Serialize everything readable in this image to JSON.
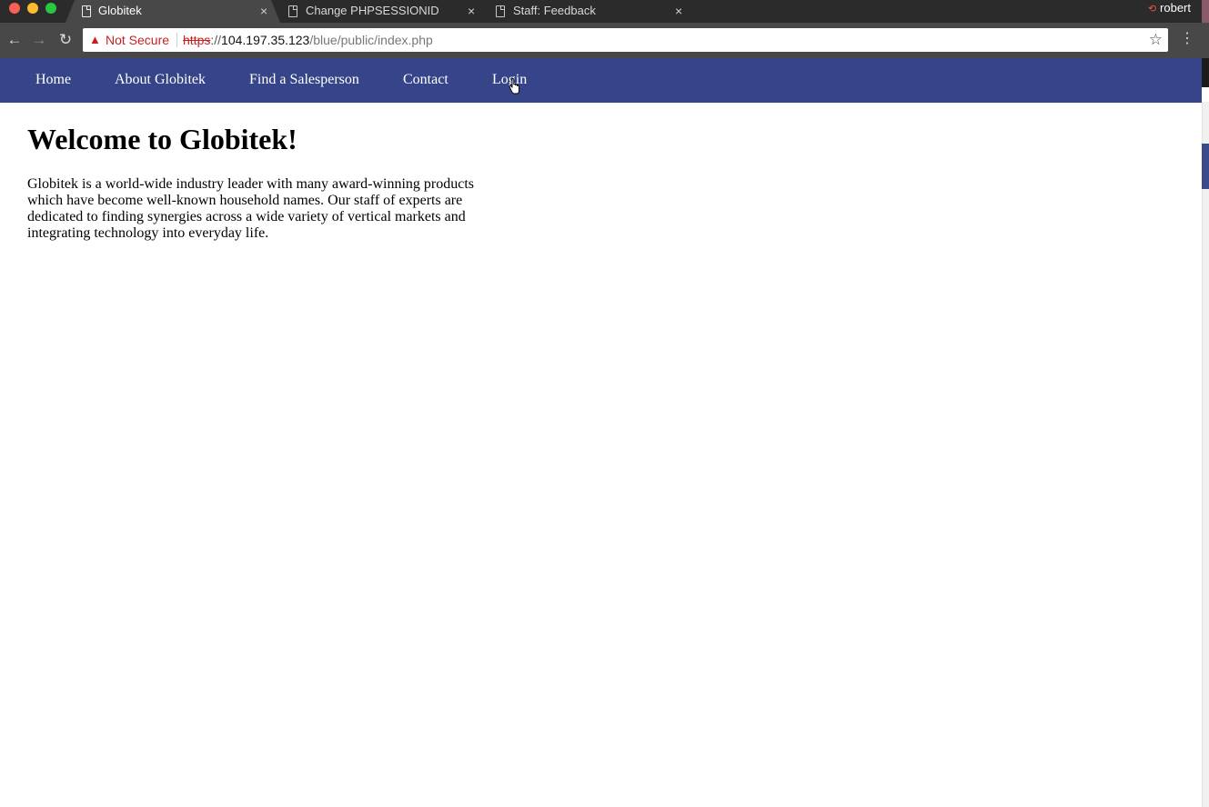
{
  "browser": {
    "tabs": [
      {
        "title": "Globitek",
        "active": true
      },
      {
        "title": "Change PHPSESSIONID",
        "active": false
      },
      {
        "title": "Staff: Feedback",
        "active": false
      }
    ],
    "tab_close_glyph": "×",
    "user": "robert",
    "omnibox": {
      "security_label": "Not Secure",
      "url_scheme": "https",
      "url_separator": "://",
      "url_host": "104.197.35.123",
      "url_path": "/blue/public/index.php"
    },
    "icons": {
      "back": "back-arrow-icon",
      "forward": "forward-arrow-icon",
      "reload": "reload-icon",
      "warning": "warning-icon",
      "bookmark": "star-icon",
      "menu": "kebab-menu-icon",
      "tab_page": "page-icon"
    }
  },
  "site": {
    "nav": [
      {
        "label": "Home"
      },
      {
        "label": "About Globitek"
      },
      {
        "label": "Find a Salesperson"
      },
      {
        "label": "Contact"
      },
      {
        "label": "Login"
      }
    ],
    "heading": "Welcome to Globitek!",
    "intro": "Globitek is a world-wide industry leader with many award-winning products which have become well-known household names. Our staff of experts are dedicated to finding synergies across a wide variety of vertical markets and integrating technology into everyday life."
  },
  "colors": {
    "nav_background": "#364589",
    "not_secure_red": "#c5221f",
    "chrome_dark": "#2b2b2b",
    "chrome_toolbar": "#484848"
  }
}
